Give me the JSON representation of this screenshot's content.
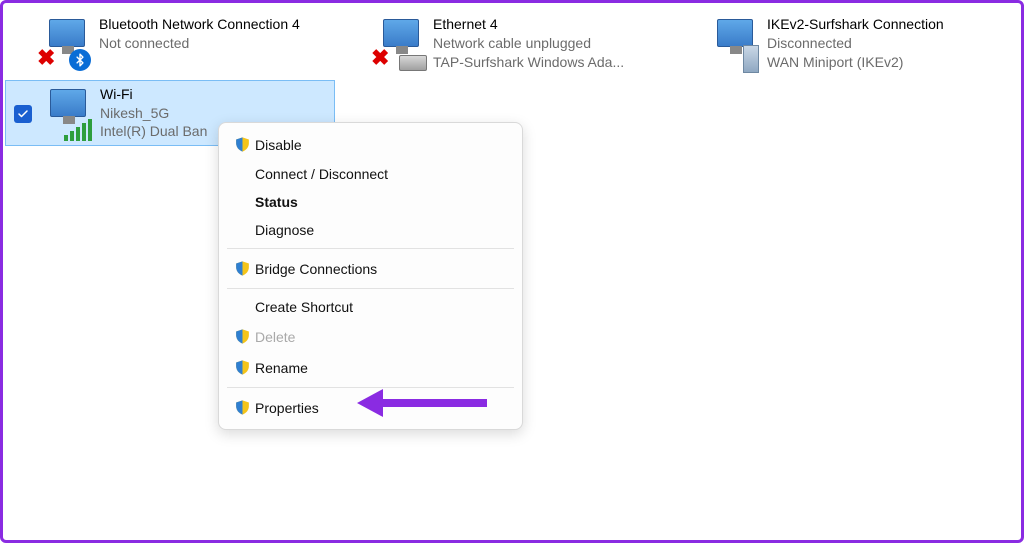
{
  "adapters": {
    "bluetooth": {
      "name": "Bluetooth Network Connection 4",
      "status": "Not connected"
    },
    "ethernet": {
      "name": "Ethernet 4",
      "status": "Network cable unplugged",
      "device": "TAP-Surfshark Windows Ada..."
    },
    "ikev2": {
      "name": "IKEv2-Surfshark Connection",
      "status": "Disconnected",
      "device": "WAN Miniport (IKEv2)"
    },
    "wifi": {
      "name": "Wi-Fi",
      "ssid": "Nikesh_5G",
      "device": "Intel(R) Dual Ban"
    }
  },
  "menu": {
    "disable": "Disable",
    "connect": "Connect / Disconnect",
    "status": "Status",
    "diagnose": "Diagnose",
    "bridge": "Bridge Connections",
    "shortcut": "Create Shortcut",
    "delete": "Delete",
    "rename": "Rename",
    "properties": "Properties"
  }
}
